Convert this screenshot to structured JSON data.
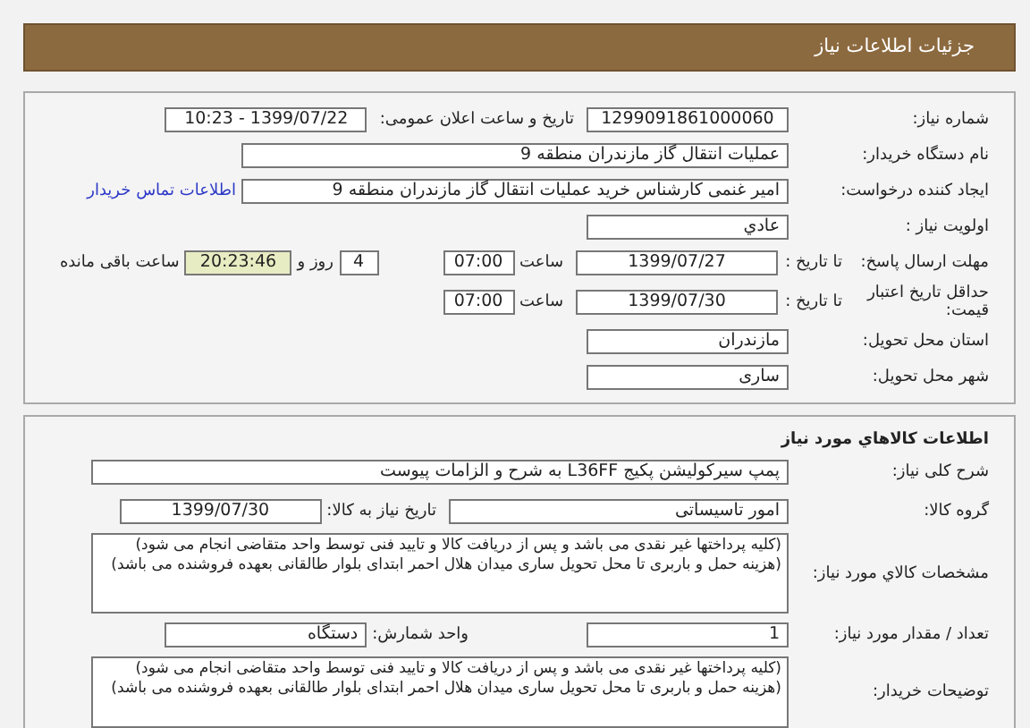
{
  "header": {
    "title": "جزئیات اطلاعات نیاز"
  },
  "need_info": {
    "need_number": {
      "label": "شماره نیاز:",
      "value": "1299091861000060"
    },
    "announce": {
      "label": "تاریخ و ساعت اعلان عمومی:",
      "value": "1399/07/22 - 10:23"
    },
    "buyer": {
      "label": "نام دستگاه خریدار:",
      "value": "عملیات انتقال گاز مازندران منطقه 9"
    },
    "requester": {
      "label": "ایجاد کننده درخواست:",
      "value": "امیر غنمی کارشناس خرید عملیات انتقال گاز مازندران منطقه 9",
      "link": "اطلاعات تماس خریدار"
    },
    "priority": {
      "label": "اولویت نیاز :",
      "value": "عادي"
    },
    "deadline": {
      "label": "مهلت ارسال پاسخ:",
      "to_date_label": "تا تاریخ :",
      "date": "1399/07/27",
      "time_label": "ساعت",
      "time": "07:00",
      "days": "4",
      "days_label": "روز و",
      "remaining": "20:23:46",
      "remaining_label": "ساعت باقی مانده"
    },
    "validity": {
      "label": "حداقل تاریخ اعتبار قیمت:",
      "to_date_label": "تا تاریخ :",
      "date": "1399/07/30",
      "time_label": "ساعت",
      "time": "07:00"
    },
    "province": {
      "label": "استان محل تحویل:",
      "value": "مازندران"
    },
    "city": {
      "label": "شهر محل تحویل:",
      "value": "ساری"
    }
  },
  "goods": {
    "title": "اطلاعات کالاهاي مورد نیاز",
    "description": {
      "label": "شرح کلی نیاز:",
      "value": "پمپ سیرکولیشن پکیج L36FF به شرح و الزامات پیوست"
    },
    "group": {
      "label": "گروه کالا:",
      "value": "امور تاسیساتی",
      "need_date_label": "تاریخ نیاز به کالا:",
      "need_date": "1399/07/30"
    },
    "specs": {
      "label": "مشخصات کالاي مورد نیاز:",
      "value": "(کلیه پرداختها غیر نقدی می باشد و پس از دریافت کالا و تایید فنی توسط واحد متقاضی انجام می شود)(هزینه حمل و باربری تا محل تحویل ساری میدان هلال احمر ابتدای بلوار طالقانی بعهده فروشنده می باشد)"
    },
    "quantity": {
      "label": "تعداد / مقدار مورد نیاز:",
      "value": "1",
      "unit_label": "واحد شمارش:",
      "unit": "دستگاه"
    },
    "buyer_notes": {
      "label": "توضیحات خریدار:",
      "value": "(کلیه پرداختها غیر نقدی می باشد و پس از دریافت کالا و تایید فنی توسط واحد متقاضی انجام می شود)(هزینه حمل و باربری تا محل تحویل ساری میدان هلال احمر ابتدای بلوار طالقانی بعهده فروشنده می باشد)"
    }
  }
}
